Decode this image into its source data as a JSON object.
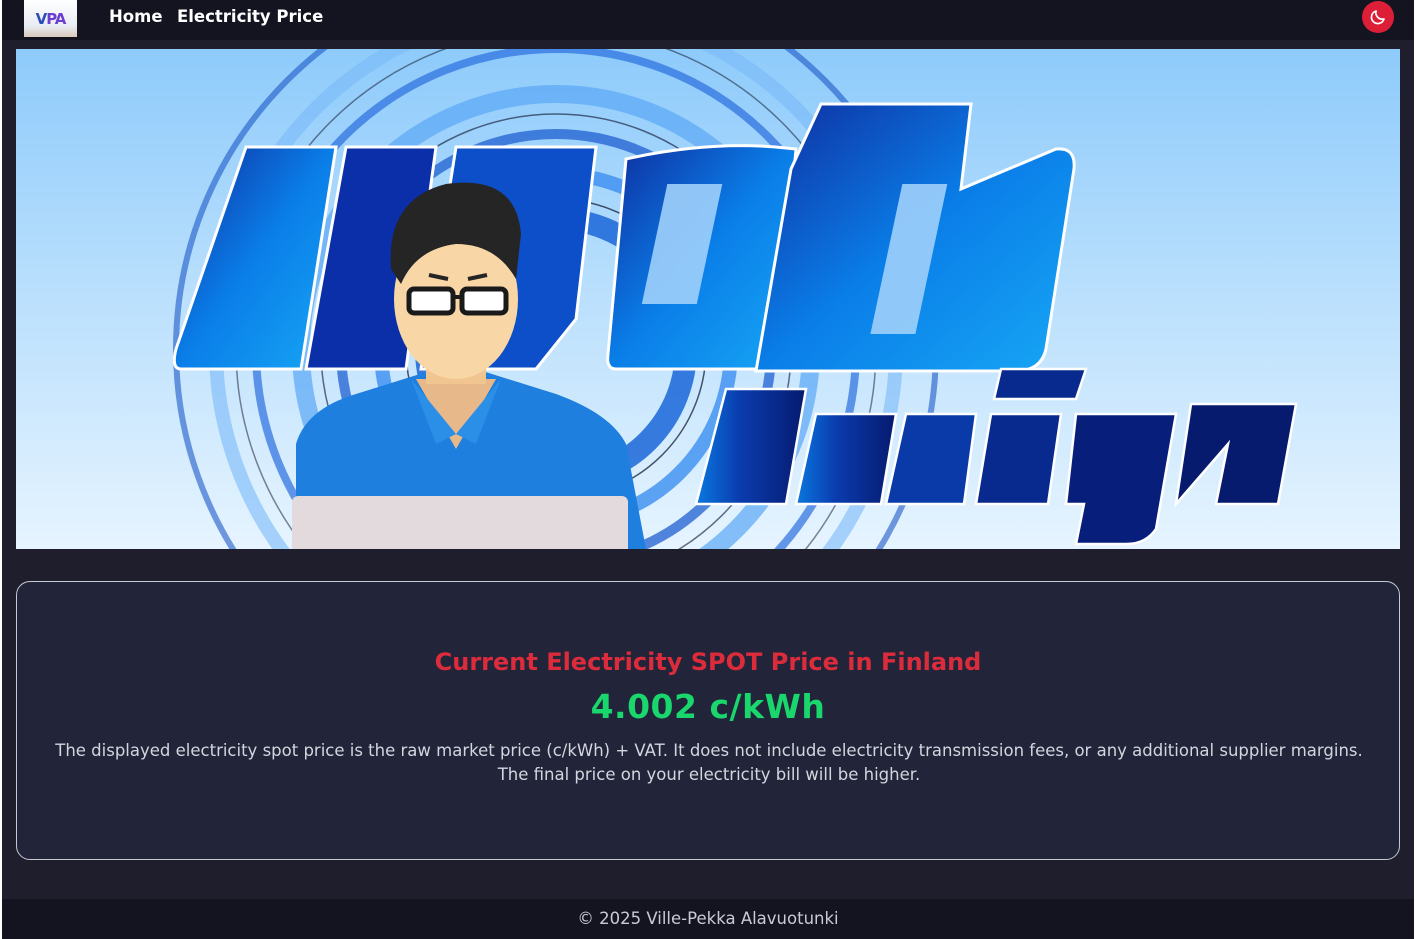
{
  "nav": {
    "logo_text_a": "V",
    "logo_text_b": "PA",
    "links": [
      "Home",
      "Electricity Price"
    ],
    "theme_icon": "moon-icon",
    "theme_color": "#dc1f37"
  },
  "hero": {
    "image_subject": "web design illustration",
    "word_1": "web",
    "word_2": "design"
  },
  "price_card": {
    "title": "Current Electricity SPOT Price in Finland",
    "price": "4.002 c/kWh",
    "note": "The displayed electricity spot price is the raw market price (c/kWh) + VAT. It does not include electricity transmission fees, or any additional supplier margins. The final price on your electricity bill will be higher.",
    "title_color": "#dc2c3c",
    "price_color": "#19d66d"
  },
  "footer": {
    "copyright": "© 2025 Ville-Pekka Alavuotunki"
  }
}
